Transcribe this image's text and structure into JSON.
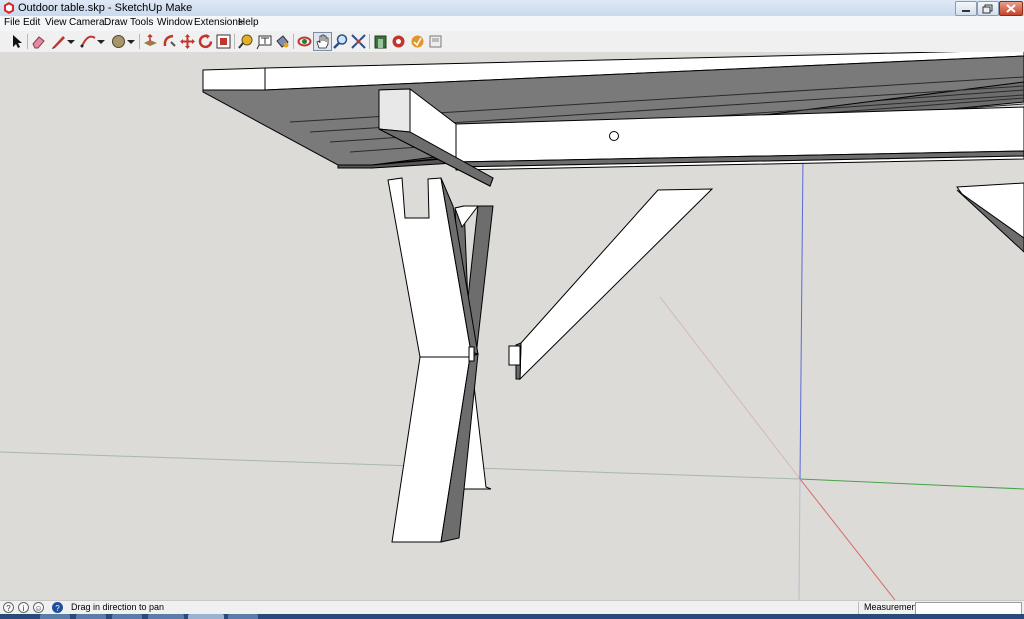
{
  "window": {
    "title": "Outdoor table.skp - SketchUp Make",
    "app_icon": "sketchup-logo-icon",
    "controls": [
      "minimize-icon",
      "restore-icon",
      "close-icon"
    ]
  },
  "menu": {
    "items": [
      "File",
      "Edit",
      "View",
      "Camera",
      "Draw",
      "Tools",
      "Window",
      "Extensions",
      "Help"
    ]
  },
  "toolbar": {
    "tools": [
      {
        "name": "select",
        "icon": "select-arrow-icon"
      },
      {
        "name": "eraser",
        "icon": "eraser-icon"
      },
      {
        "name": "line",
        "icon": "pencil-icon"
      },
      {
        "name": "arc",
        "icon": "arc-icon"
      },
      {
        "name": "shapes",
        "icon": "circle-shape-icon"
      },
      {
        "name": "push-pull",
        "icon": "push-pull-icon"
      },
      {
        "name": "follow-me",
        "icon": "follow-me-icon"
      },
      {
        "name": "move",
        "icon": "move-icon"
      },
      {
        "name": "rotate",
        "icon": "rotate-icon"
      },
      {
        "name": "scale",
        "icon": "scale-icon"
      },
      {
        "name": "tape-measure",
        "icon": "tape-measure-icon"
      },
      {
        "name": "text",
        "icon": "text-icon"
      },
      {
        "name": "paint-bucket",
        "icon": "paint-bucket-icon"
      },
      {
        "name": "orbit",
        "icon": "orbit-icon"
      },
      {
        "name": "pan",
        "icon": "pan-hand-icon",
        "active": true
      },
      {
        "name": "zoom",
        "icon": "zoom-icon"
      },
      {
        "name": "zoom-extents",
        "icon": "zoom-extents-icon"
      },
      {
        "name": "3d-warehouse",
        "icon": "warehouse-icon"
      },
      {
        "name": "extension-warehouse",
        "icon": "extension-warehouse-icon"
      },
      {
        "name": "share-model",
        "icon": "share-model-icon"
      },
      {
        "name": "layout",
        "icon": "layout-icon"
      }
    ]
  },
  "status": {
    "message": "Drag in direction to pan",
    "icons": [
      "geo-location-icon",
      "credits-icon",
      "user-icon",
      "help-icon"
    ],
    "measurements_label": "Measurements",
    "measurements_value": ""
  },
  "colors": {
    "viewport_bg": "#dcdbd7",
    "axis_red": "#d66a6a",
    "axis_green": "#4aa34a",
    "axis_blue": "#5a6ad6",
    "face_white": "#ffffff",
    "face_shade": "#6d6d6d",
    "edge": "#000000"
  }
}
